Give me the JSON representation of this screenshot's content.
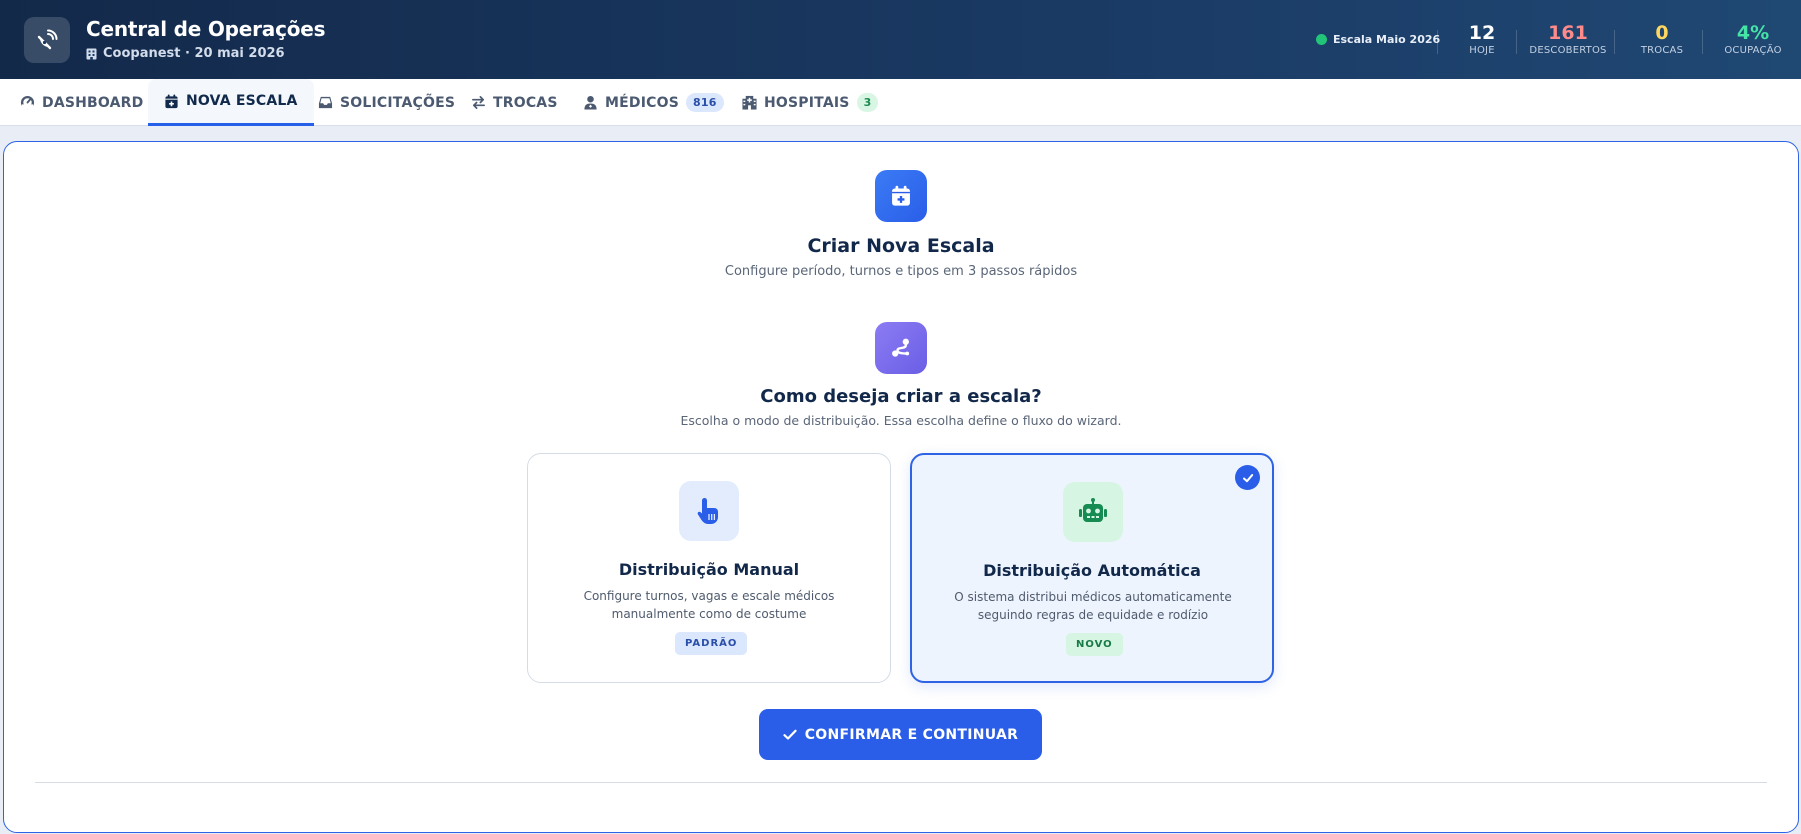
{
  "header": {
    "title": "Central de Operações",
    "subtitle": "Coopanest · 20 mai 2026",
    "status": "Escala Maio 2026",
    "stats": [
      {
        "value": "12",
        "label": "HOJE",
        "color": "#ffffff"
      },
      {
        "value": "161",
        "label": "DESCOBERTOS",
        "color": "#ff8a8a"
      },
      {
        "value": "0",
        "label": "TROCAS",
        "color": "#ffd75e"
      },
      {
        "value": "4%",
        "label": "OCUPAÇÃO",
        "color": "#46e3a6"
      }
    ]
  },
  "tabs": [
    {
      "label": "DASHBOARD",
      "icon": "gauge-icon"
    },
    {
      "label": "NOVA ESCALA",
      "icon": "calendar-plus-icon",
      "active": true
    },
    {
      "label": "SOLICITAÇÕES",
      "icon": "inbox-icon"
    },
    {
      "label": "TROCAS",
      "icon": "swap-icon"
    },
    {
      "label": "MÉDICOS",
      "icon": "doctor-icon",
      "badge": "816"
    },
    {
      "label": "HOSPITAIS",
      "icon": "hospital-icon",
      "badge": "3"
    }
  ],
  "main": {
    "title": "Criar Nova Escala",
    "subtitle": "Configure período, turnos e tipos em 3 passos rápidos",
    "question": "Como deseja criar a escala?",
    "question_sub": "Escolha o modo de distribuição. Essa escolha define o fluxo do wizard.",
    "cards": [
      {
        "title": "Distribuição Manual",
        "desc": "Configure turnos, vagas e escale médicos manualmente como de costume",
        "tag": "PADRÃO",
        "selected": false
      },
      {
        "title": "Distribuição Automática",
        "desc": "O sistema distribui médicos automaticamente seguindo regras de equidade e rodízio",
        "tag": "NOVO",
        "selected": true
      }
    ],
    "confirm_label": "CONFIRMAR E CONTINUAR"
  },
  "colors": {
    "accent": "#2a5ee8",
    "header_bg": "#13294a",
    "status_ok": "#22c47a"
  }
}
